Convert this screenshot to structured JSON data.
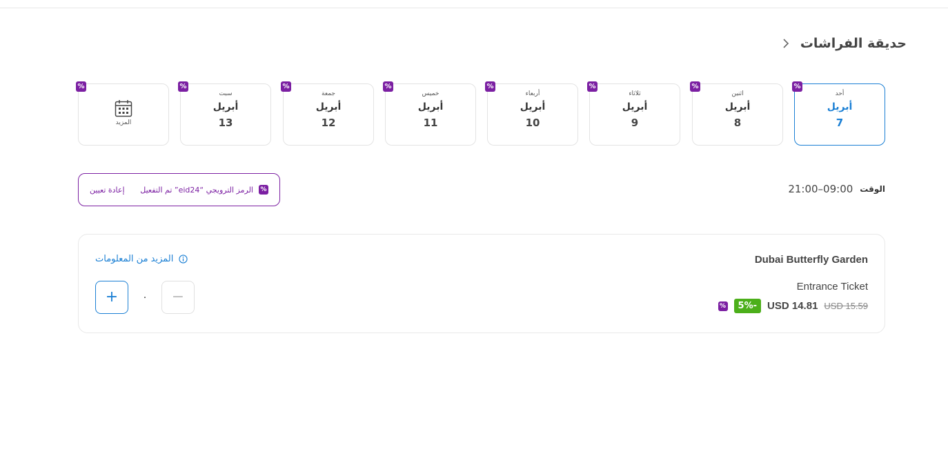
{
  "header": {
    "title": "حديقة الفراشات",
    "back_icon": "chevron-right-icon"
  },
  "dates": [
    {
      "dow": "أحد",
      "month": "أبريل",
      "day": "7",
      "selected": true
    },
    {
      "dow": "اثنين",
      "month": "أبريل",
      "day": "8",
      "selected": false
    },
    {
      "dow": "ثلاثاء",
      "month": "أبريل",
      "day": "9",
      "selected": false
    },
    {
      "dow": "أربعاء",
      "month": "أبريل",
      "day": "10",
      "selected": false
    },
    {
      "dow": "خميس",
      "month": "أبريل",
      "day": "11",
      "selected": false
    },
    {
      "dow": "جمعة",
      "month": "أبريل",
      "day": "12",
      "selected": false
    },
    {
      "dow": "سبت",
      "month": "أبريل",
      "day": "13",
      "selected": false
    }
  ],
  "more_dates": {
    "label": "المزيد",
    "icon": "calendar-icon"
  },
  "promo_badge": "%",
  "promo": {
    "message": "الرمز الترويجي “eid24” تم التفعيل",
    "reset_label": "إعادة تعيين"
  },
  "time": {
    "label": "الوقت",
    "value": "21:00–09:00"
  },
  "ticket": {
    "title": "Dubai Butterfly Garden",
    "type": "Entrance Ticket",
    "old_price": "USD 15.59",
    "new_price": "USD 14.81",
    "discount": "-5%",
    "more_info_label": "المزيد من المعلومات",
    "quantity": "٠",
    "plus_label": "+",
    "minus_label": "−"
  },
  "colors": {
    "accent": "#1a7fd4",
    "promo": "#7b1fa2",
    "discount": "#4caf1a"
  }
}
